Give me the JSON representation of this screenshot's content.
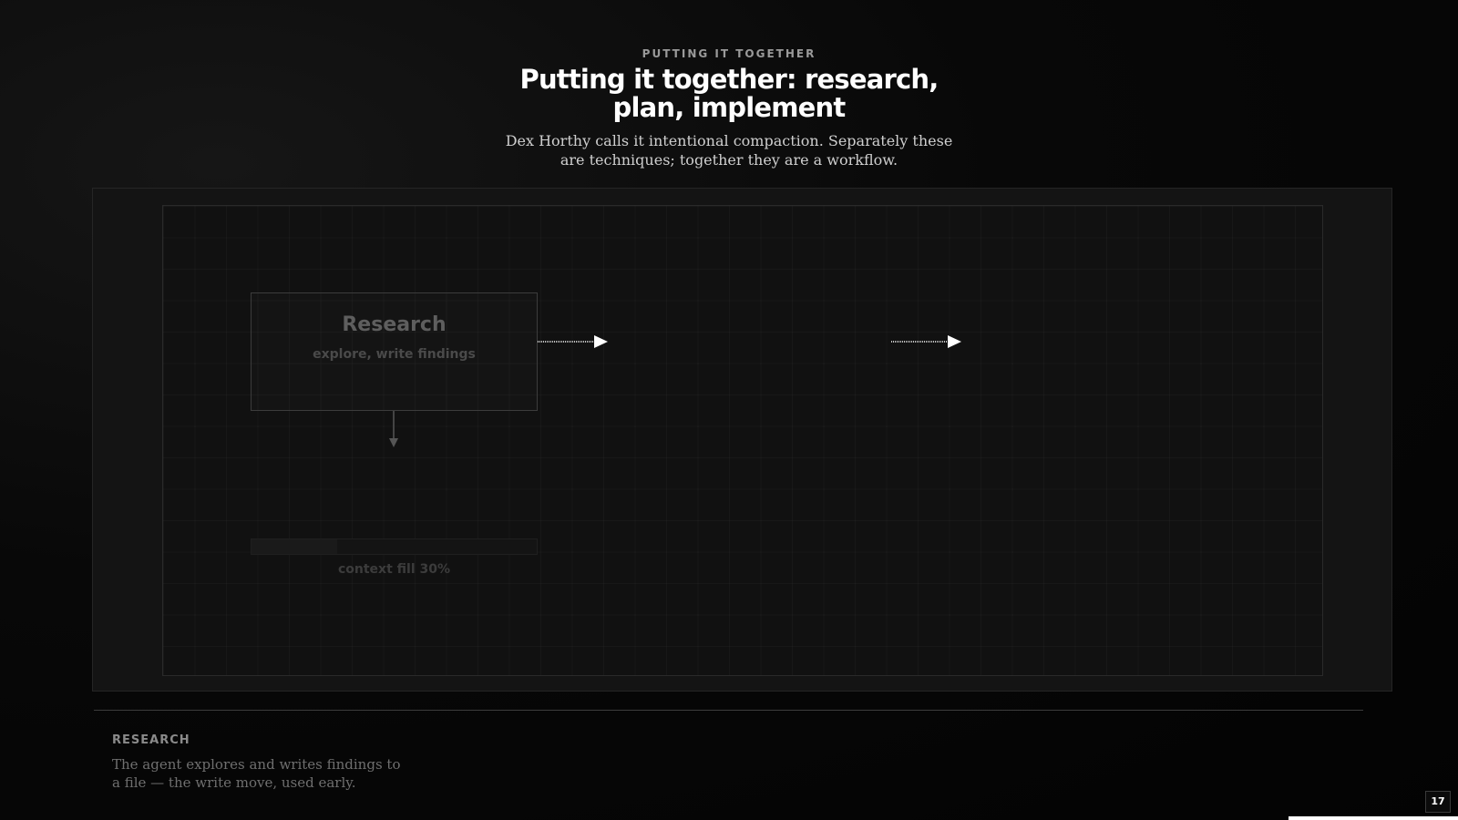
{
  "header": {
    "eyebrow": "PUTTING IT TOGETHER",
    "title": "Putting it together: research, plan, implement",
    "subtitle": "Dex Horthy calls it intentional compaction. Separately these are techniques; together they are a workflow."
  },
  "diagram": {
    "steps": [
      {
        "title": "Research",
        "subtitle": "explore, write findings",
        "context_fill_label": "context fill 30%",
        "context_fill": 0.3
      }
    ],
    "colors": {
      "arrow": "#ffffff",
      "arrow_down": "#555555",
      "box_border": "#3c3c3c"
    }
  },
  "caption": {
    "label": "RESEARCH",
    "text": "The agent explores and writes findings to a file — the write move, used early."
  },
  "footer": {
    "page_number": "17"
  }
}
